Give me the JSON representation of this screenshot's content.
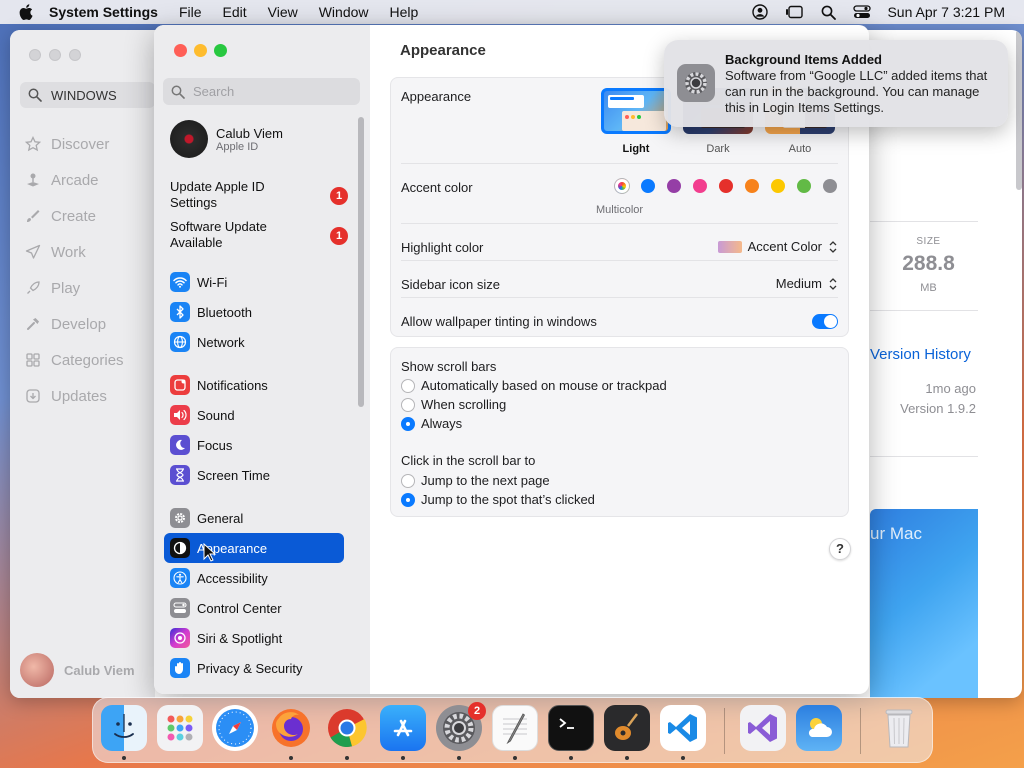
{
  "menubar": {
    "app_name": "System Settings",
    "menus": [
      "File",
      "Edit",
      "View",
      "Window",
      "Help"
    ],
    "clock": "Sun Apr 7  3:21 PM"
  },
  "appstore": {
    "search_value": "WINDOWS",
    "nav": [
      "Discover",
      "Arcade",
      "Create",
      "Work",
      "Play",
      "Develop",
      "Categories",
      "Updates"
    ],
    "user_name": "Calub Viem",
    "size_label": "SIZE",
    "size_value": "288.8",
    "size_unit": "MB",
    "version_history": "Version History",
    "ago": "1mo ago",
    "version": "Version 1.9.2",
    "banner_text": "ur Mac"
  },
  "sidebar": {
    "search_placeholder": "Search",
    "account": {
      "name": "Calub Viem",
      "subtitle": "Apple ID"
    },
    "alerts": [
      {
        "label": "Update Apple ID Settings",
        "badge": "1"
      },
      {
        "label": "Software Update Available",
        "badge": "1"
      }
    ],
    "items": [
      {
        "label": "Wi-Fi",
        "icon": "wifi-icon",
        "color": "#1a84f5"
      },
      {
        "label": "Bluetooth",
        "icon": "bluetooth-icon",
        "color": "#1a84f5"
      },
      {
        "label": "Network",
        "icon": "globe-icon",
        "color": "#1a84f5"
      },
      {
        "label": "Notifications",
        "icon": "bell-icon",
        "color": "#ec3d3d"
      },
      {
        "label": "Sound",
        "icon": "speaker-icon",
        "color": "#ec3d4a"
      },
      {
        "label": "Focus",
        "icon": "moon-icon",
        "color": "#5b4fd1"
      },
      {
        "label": "Screen Time",
        "icon": "hourglass-icon",
        "color": "#5b4fd1"
      },
      {
        "label": "General",
        "icon": "gear-icon",
        "color": "#8e8e93"
      },
      {
        "label": "Appearance",
        "icon": "appearance-icon",
        "color": "#111111"
      },
      {
        "label": "Accessibility",
        "icon": "accessibility-icon",
        "color": "#1a84f5"
      },
      {
        "label": "Control Center",
        "icon": "control-center-icon",
        "color": "#8e8e93"
      },
      {
        "label": "Siri & Spotlight",
        "icon": "siri-icon",
        "color": "#b03ad6"
      },
      {
        "label": "Privacy & Security",
        "icon": "hand-icon",
        "color": "#1a84f5"
      }
    ],
    "selected": "Appearance"
  },
  "content": {
    "title": "Appearance",
    "appearance_label": "Appearance",
    "themes": [
      "Light",
      "Dark",
      "Auto"
    ],
    "selected_theme": "Light",
    "accent_label": "Accent color",
    "accent_colors": [
      "multicolor",
      "#0a7aff",
      "#953ea6",
      "#f23d8e",
      "#e5302b",
      "#f7821b",
      "#fcc800",
      "#62ba46",
      "#8e8e93"
    ],
    "multicolor_label": "Multicolor",
    "highlight_label": "Highlight color",
    "highlight_value": "Accent Color",
    "sidebar_icon_label": "Sidebar icon size",
    "sidebar_icon_value": "Medium",
    "tinting_label": "Allow wallpaper tinting in windows",
    "tinting_on": true,
    "scroll_label": "Show scroll bars",
    "scroll_options": [
      "Automatically based on mouse or trackpad",
      "When scrolling",
      "Always"
    ],
    "scroll_selected": "Always",
    "click_label": "Click in the scroll bar to",
    "click_options": [
      "Jump to the next page",
      "Jump to the spot that’s clicked"
    ],
    "click_selected": "Jump to the spot that’s clicked",
    "help": "?"
  },
  "notification": {
    "title": "Background Items Added",
    "body": "Software from “Google LLC” added items that can run in the background. You can manage this in Login Items Settings."
  },
  "dock": {
    "apps": [
      "Finder",
      "Launchpad",
      "Safari",
      "Firefox",
      "Chrome",
      "App Store",
      "System Settings",
      "TextEdit",
      "Terminal",
      "GarageBand",
      "Visual Studio Code",
      "Visual Studio",
      "Weather",
      "Trash"
    ],
    "settings_badge": "2"
  }
}
